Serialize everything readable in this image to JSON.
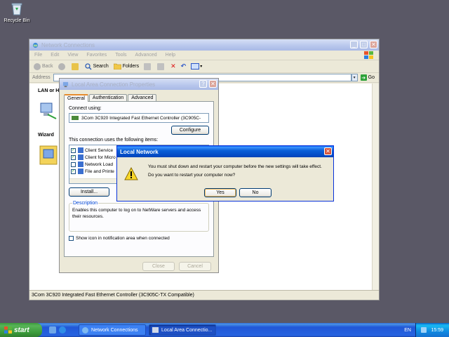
{
  "desktop": {
    "recycle_bin_label": "Recycle Bin"
  },
  "network_window": {
    "title": "Network Connections",
    "menu": [
      "File",
      "Edit",
      "View",
      "Favorites",
      "Tools",
      "Advanced",
      "Help"
    ],
    "toolbar": {
      "back": "Back",
      "search": "Search",
      "folders": "Folders"
    },
    "address_label": "Address",
    "go_label": "Go",
    "lan_header": "LAN or H",
    "wizard_header": "Wizard",
    "status_text": "3Com 3C920 Integrated Fast Ethernet Controller (3C905C-TX Compatible)"
  },
  "properties_dialog": {
    "title": "Local Area Connection Properties",
    "tabs": [
      "General",
      "Authentication",
      "Advanced"
    ],
    "connect_using_label": "Connect using:",
    "adapter_name": "3Com 3C920 Integrated Fast Ethernet Controller (3C905C-",
    "configure_button": "Configure",
    "components_label": "This connection uses the following items:",
    "components": [
      "Client Service",
      "Client for Micro",
      "Network Load",
      "File and Printe"
    ],
    "install_button": "Install...",
    "description_legend": "Description",
    "description_text": "Enables this computer to log on to NetWare servers and access their resources.",
    "show_icon_label": "Show icon in notification area when connected",
    "close_button": "Close",
    "cancel_button": "Cancel"
  },
  "message_box": {
    "title": "Local Network",
    "line1": "You must shut down and restart your computer before the new settings will take effect.",
    "line2": "Do you want to restart your computer now?",
    "yes_button": "Yes",
    "no_button": "No"
  },
  "taskbar": {
    "start_label": "start",
    "tasks": [
      "Network Connections",
      "Local Area Connectio..."
    ],
    "language": "EN",
    "clock": "15:59"
  }
}
